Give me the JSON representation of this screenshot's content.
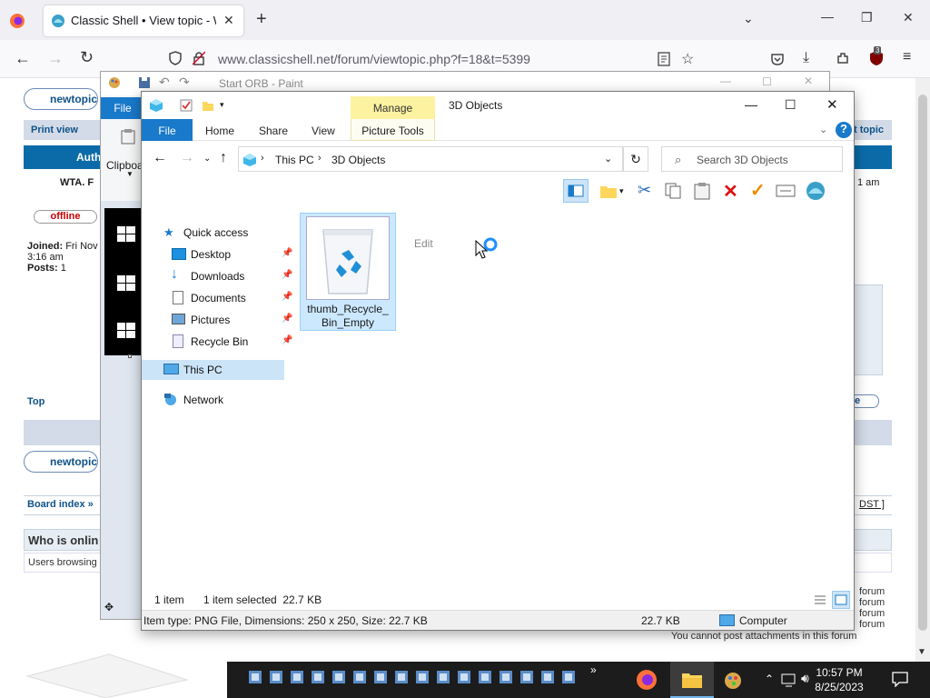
{
  "browser": {
    "tab_title": "Classic Shell • View topic - Win",
    "url": "www.classicshell.net/forum/viewtopic.php?f=18&t=5399",
    "ublock_count": "3"
  },
  "forum": {
    "newtopic_label": "newtopic",
    "print_view": "Print view",
    "author_hdr": "Auth",
    "username": "WTA. F",
    "status_badge": "offline",
    "joined_label": "Joined:",
    "joined_value": "Fri Nov",
    "joined_time": "3:16 am",
    "posts_label": "Posts:",
    "posts_value": "1",
    "top_link": "Top",
    "board_index": "Board index »",
    "who_online": "Who is onlin",
    "users_browsing": "Users browsing",
    "post_topic": "t topic",
    "time_right": "1 am",
    "dst": "DST ]",
    "reply_right": "e",
    "perm_lines": [
      "forum",
      "forum",
      "forum",
      "forum"
    ],
    "perm_last": "You cannot post attachments in this forum"
  },
  "paint": {
    "title": "Start ORB - Paint",
    "file_tab": "File",
    "clipboard": "Clipboa"
  },
  "explorer": {
    "window_title": "3D Objects",
    "manage_label": "Manage",
    "ribbon_tabs": [
      "File",
      "Home",
      "Share",
      "View"
    ],
    "picture_tools": "Picture Tools",
    "breadcrumb": [
      "This PC",
      "3D Objects"
    ],
    "search_placeholder": "Search 3D Objects",
    "nav": {
      "quick_access": "Quick access",
      "items": [
        "Desktop",
        "Downloads",
        "Documents",
        "Pictures",
        "Recycle Bin"
      ],
      "this_pc": "This PC",
      "network": "Network"
    },
    "file": {
      "name_line1": "thumb_Recycle_",
      "name_line2": "Bin_Empty"
    },
    "edit_hint": "Edit",
    "status": {
      "count": "1 item",
      "selected": "1 item selected  22.7 KB"
    },
    "details": {
      "info": "Item type: PNG File, Dimensions: 250 x 250, Size: 22.7 KB",
      "size": "22.7 KB",
      "location": "Computer"
    }
  },
  "taskbar": {
    "time": "10:57 PM",
    "date": "8/25/2023"
  }
}
